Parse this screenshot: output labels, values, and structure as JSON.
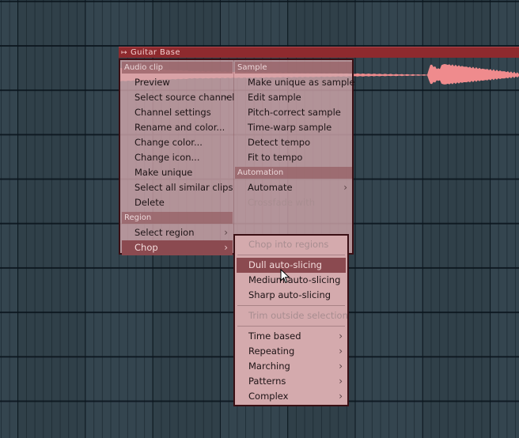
{
  "clip": {
    "name": "Guitar Base",
    "icon": "audio-clip-icon",
    "color": "#8e2a2e",
    "waveform_color": "#ef8b8d"
  },
  "context_menu": {
    "left_column": {
      "sections": [
        {
          "title": "Audio clip",
          "items": [
            {
              "label": "Preview",
              "has_submenu": false,
              "disabled": false
            },
            {
              "label": "Select source channel",
              "has_submenu": true,
              "disabled": false
            },
            {
              "label": "Channel settings",
              "has_submenu": false,
              "disabled": false
            },
            {
              "label": "Rename and color...",
              "has_submenu": false,
              "disabled": false
            },
            {
              "label": "Change color...",
              "has_submenu": false,
              "disabled": false
            },
            {
              "label": "Change icon...",
              "has_submenu": false,
              "disabled": false
            },
            {
              "label": "Make unique",
              "has_submenu": false,
              "disabled": false
            },
            {
              "label": "Select all similar clips",
              "has_submenu": false,
              "disabled": false
            },
            {
              "label": "Delete",
              "has_submenu": false,
              "disabled": false
            }
          ]
        },
        {
          "title": "Region",
          "items": [
            {
              "label": "Select region",
              "has_submenu": true,
              "disabled": false
            },
            {
              "label": "Chop",
              "has_submenu": true,
              "disabled": false,
              "active": true
            }
          ]
        }
      ]
    },
    "right_column": {
      "sections": [
        {
          "title": "Sample",
          "items": [
            {
              "label": "Make unique as sample",
              "has_submenu": false,
              "disabled": false
            },
            {
              "label": "Edit sample",
              "has_submenu": false,
              "disabled": false
            },
            {
              "label": "Pitch-correct sample",
              "has_submenu": false,
              "disabled": false
            },
            {
              "label": "Time-warp sample",
              "has_submenu": false,
              "disabled": false
            },
            {
              "label": "Detect tempo",
              "has_submenu": false,
              "disabled": false
            },
            {
              "label": "Fit to tempo",
              "has_submenu": false,
              "disabled": false
            }
          ]
        },
        {
          "title": "Automation",
          "items": [
            {
              "label": "Automate",
              "has_submenu": true,
              "disabled": false
            },
            {
              "label": "Crossfade with",
              "has_submenu": false,
              "disabled": true
            }
          ]
        }
      ]
    }
  },
  "chop_submenu": {
    "groups": [
      [
        {
          "label": "Chop into regions",
          "has_submenu": false,
          "disabled": true
        }
      ],
      [
        {
          "label": "Dull auto-slicing",
          "has_submenu": false,
          "disabled": false,
          "active": true
        },
        {
          "label": "Medium auto-slicing",
          "has_submenu": false,
          "disabled": false
        },
        {
          "label": "Sharp auto-slicing",
          "has_submenu": false,
          "disabled": false
        }
      ],
      [
        {
          "label": "Trim outside selection",
          "has_submenu": false,
          "disabled": true
        }
      ],
      [
        {
          "label": "Time based",
          "has_submenu": true,
          "disabled": false
        },
        {
          "label": "Repeating",
          "has_submenu": true,
          "disabled": false
        },
        {
          "label": "Marching",
          "has_submenu": true,
          "disabled": false
        },
        {
          "label": "Patterns",
          "has_submenu": true,
          "disabled": false
        },
        {
          "label": "Complex",
          "has_submenu": true,
          "disabled": false
        }
      ]
    ]
  },
  "arrow_glyph": "›",
  "cursor": "mouse-pointer-icon"
}
